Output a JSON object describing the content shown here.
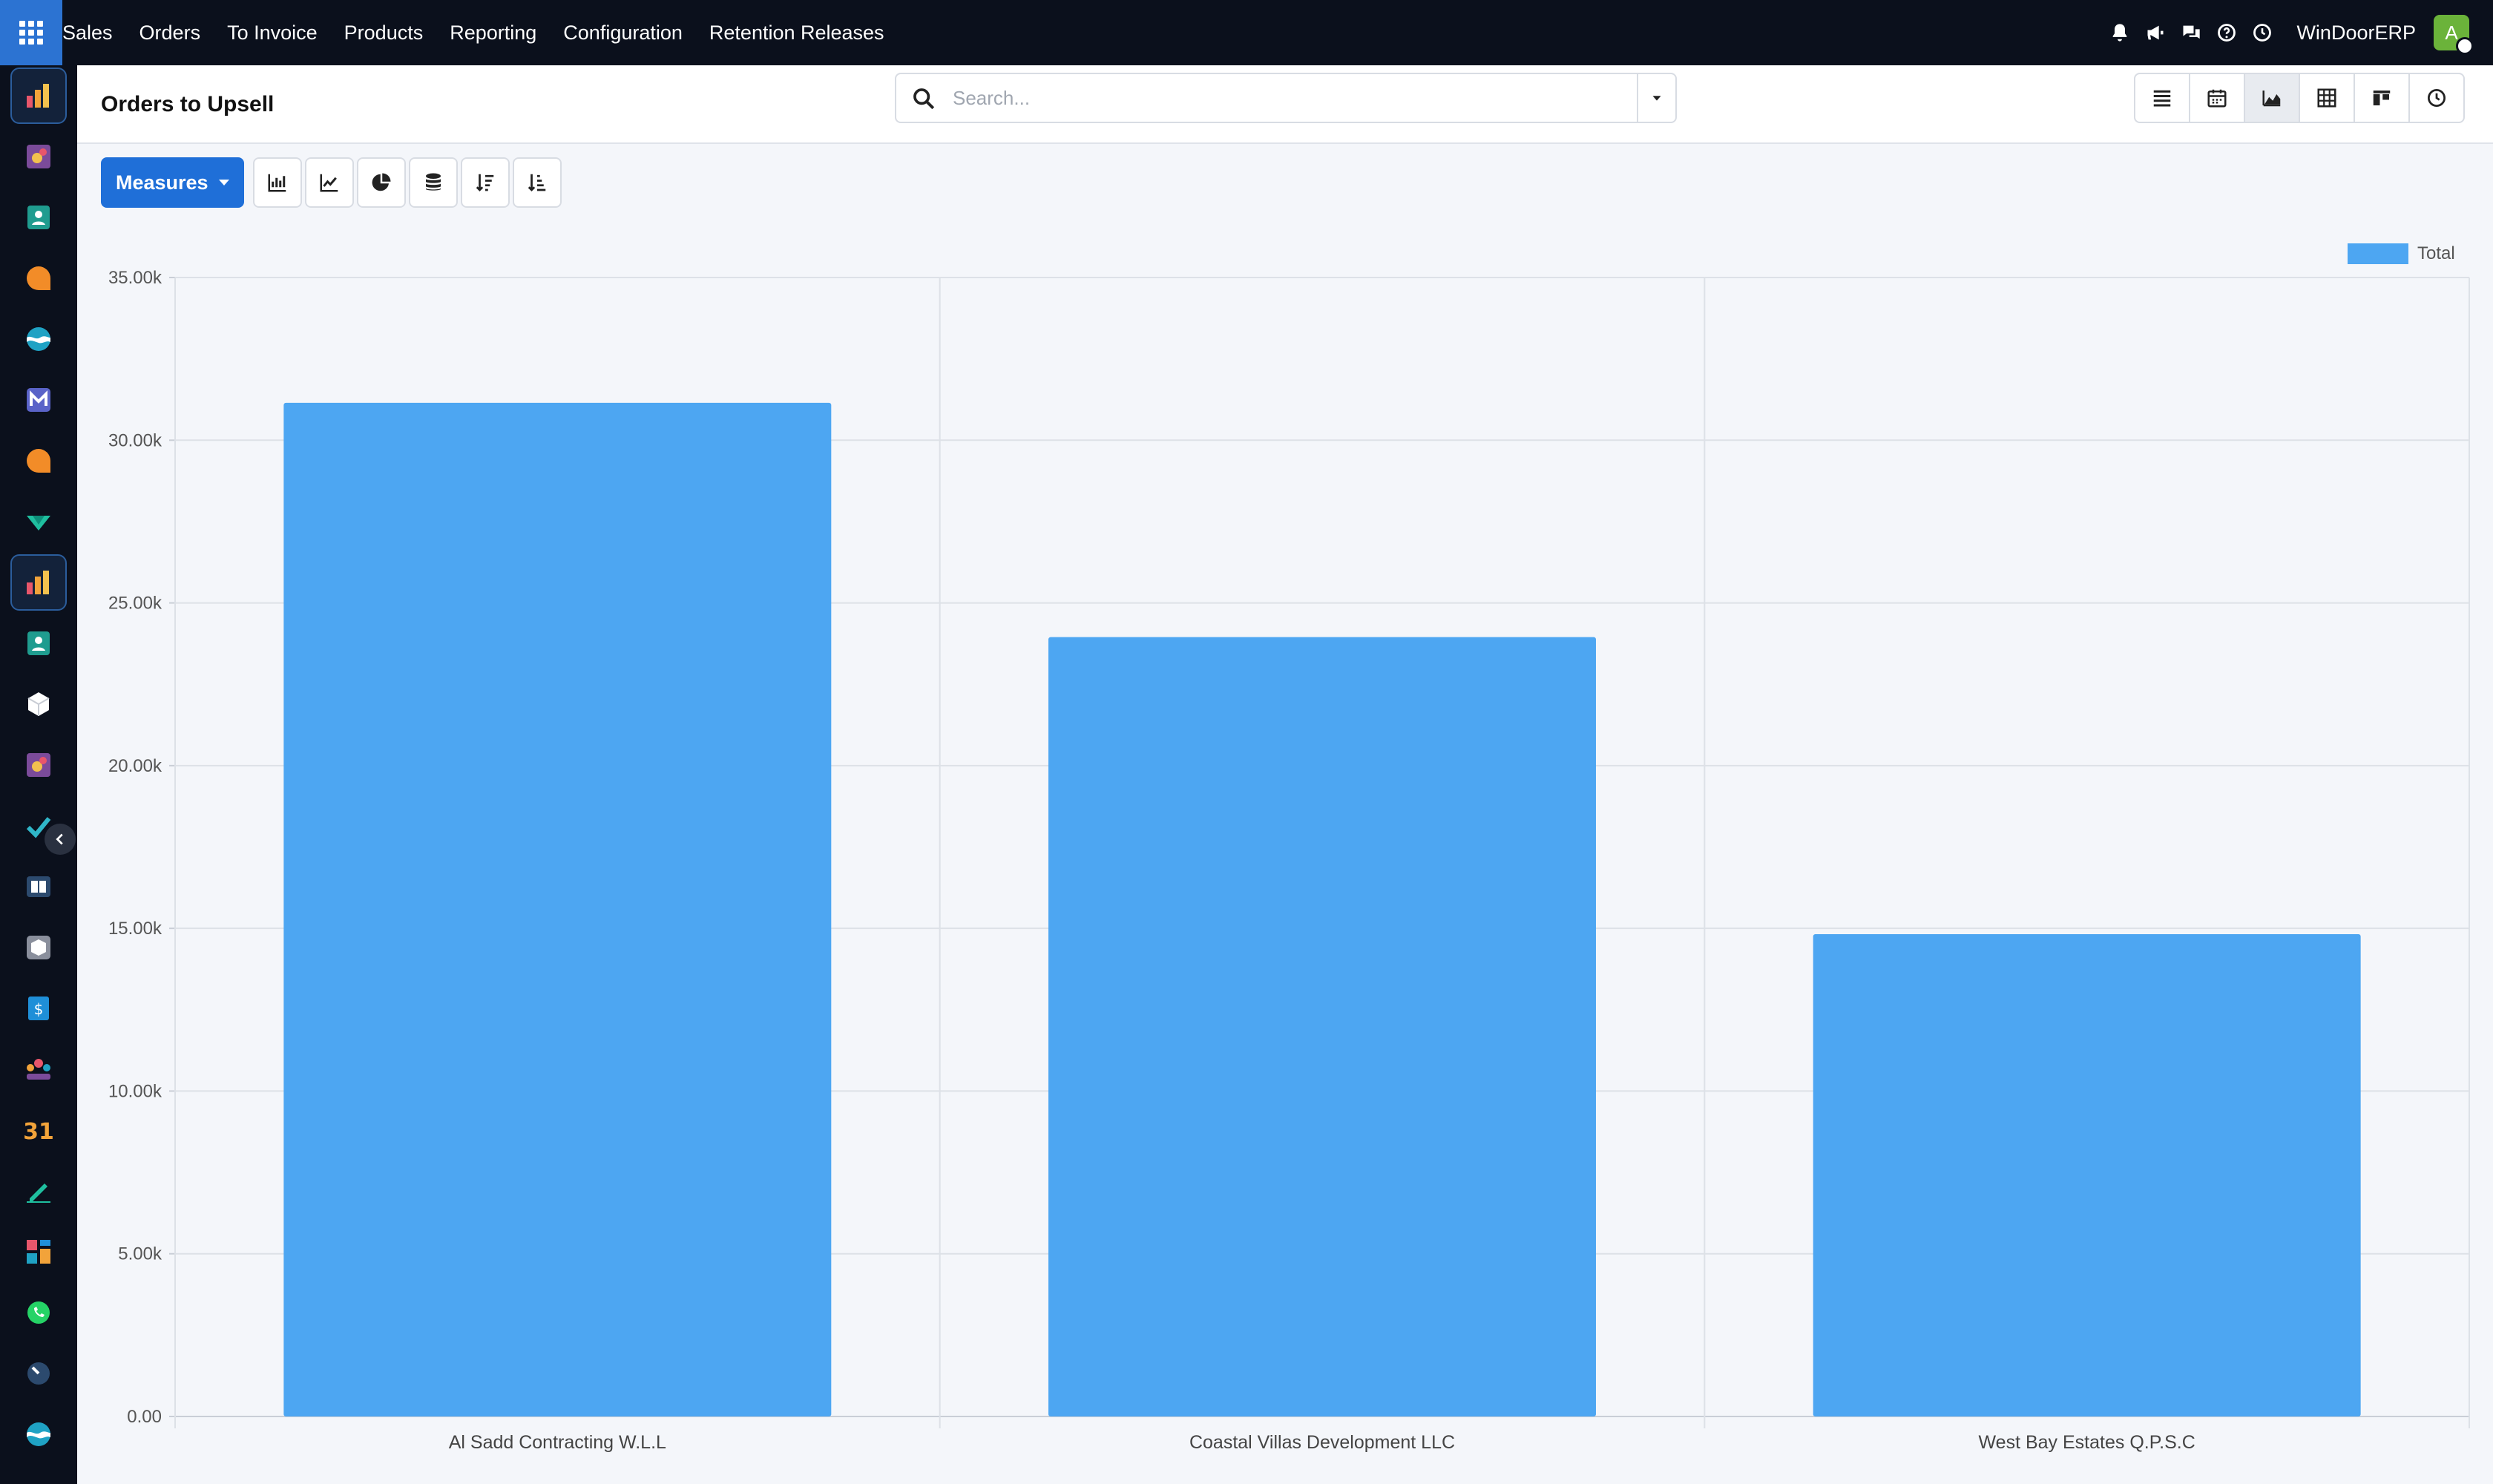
{
  "topbar": {
    "menu": [
      "Sales",
      "Orders",
      "To Invoice",
      "Products",
      "Reporting",
      "Configuration",
      "Retention Releases"
    ],
    "company": "WinDoorERP",
    "avatar_initial": "A"
  },
  "control_panel": {
    "title": "Orders to Upsell",
    "search_placeholder": "Search..."
  },
  "toolbar": {
    "measures_label": "Measures"
  },
  "colors": {
    "bar": "#4da6f2",
    "accent": "#1f6fd8",
    "navbar": "#0b101c"
  },
  "chart_data": {
    "type": "bar",
    "categories": [
      "Al Sadd Contracting W.L.L",
      "Coastal Villas Development LLC",
      "West Bay Estates Q.P.S.C"
    ],
    "series": [
      {
        "name": "Total",
        "values": [
          31150,
          23950,
          14820
        ]
      }
    ],
    "ylim": [
      0,
      35000
    ],
    "yticks": [
      0,
      5000,
      10000,
      15000,
      20000,
      25000,
      30000,
      35000
    ],
    "ytick_labels": [
      "0.00",
      "5.00k",
      "10.00k",
      "15.00k",
      "20.00k",
      "25.00k",
      "30.00k",
      "35.00k"
    ],
    "grid": true,
    "legend": "top-right"
  }
}
